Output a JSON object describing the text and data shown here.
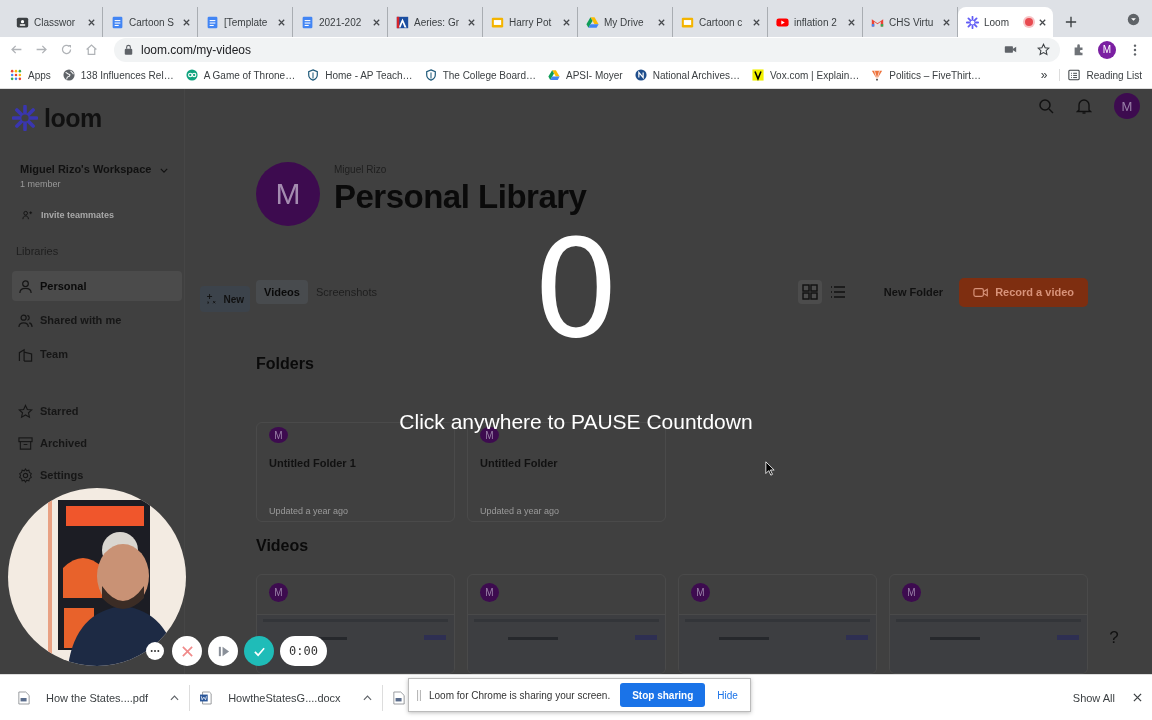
{
  "browser": {
    "tabs": [
      {
        "title": "Classwor",
        "kind": "classroom",
        "selected": false,
        "recording": false
      },
      {
        "title": "Cartoon S",
        "kind": "docs",
        "selected": false,
        "recording": false
      },
      {
        "title": "[Template",
        "kind": "docs",
        "selected": false,
        "recording": false
      },
      {
        "title": "2021-202",
        "kind": "docs",
        "selected": false,
        "recording": false
      },
      {
        "title": "Aeries: Gr",
        "kind": "aeries",
        "selected": false,
        "recording": false
      },
      {
        "title": "Harry Pot",
        "kind": "slides",
        "selected": false,
        "recording": false
      },
      {
        "title": "My Drive",
        "kind": "drive",
        "selected": false,
        "recording": false
      },
      {
        "title": "Cartoon c",
        "kind": "slides",
        "selected": false,
        "recording": false
      },
      {
        "title": "inflation 2",
        "kind": "youtube",
        "selected": false,
        "recording": false
      },
      {
        "title": "CHS Virtu",
        "kind": "gmail",
        "selected": false,
        "recording": false
      },
      {
        "title": "Loom",
        "kind": "loom",
        "selected": true,
        "recording": true
      }
    ],
    "address": "loom.com/my-videos",
    "profile": "M",
    "bookmarks": [
      {
        "label": "Apps",
        "kind": "apps"
      },
      {
        "label": "138 Influences Rel…",
        "kind": "globe"
      },
      {
        "label": "A Game of Throne…",
        "kind": "game"
      },
      {
        "label": "Home - AP Teach…",
        "kind": "shield"
      },
      {
        "label": "The College Board…",
        "kind": "shield"
      },
      {
        "label": "APSI- Moyer",
        "kind": "drive"
      },
      {
        "label": "National Archives…",
        "kind": "letter-n"
      },
      {
        "label": "Vox.com | Explain…",
        "kind": "letter-v"
      },
      {
        "label": "Politics – FiveThirt…",
        "kind": "fan"
      }
    ],
    "overflow": "»",
    "reading_list": "Reading List"
  },
  "loom": {
    "logo": "loom",
    "workspace": {
      "name": "Miguel Rizo's Workspace",
      "members": "1 member"
    },
    "invite": "Invite teammates",
    "libraries_heading": "Libraries",
    "nav": [
      {
        "label": "Personal",
        "kind": "person",
        "selected": true
      },
      {
        "label": "Shared with me",
        "kind": "people",
        "selected": false
      },
      {
        "label": "Team",
        "kind": "team",
        "selected": false
      }
    ],
    "more_nav": [
      {
        "label": "Starred",
        "kind": "star"
      },
      {
        "label": "Archived",
        "kind": "archive"
      },
      {
        "label": "Settings",
        "kind": "gear"
      }
    ],
    "account_avatar": "M",
    "user_avatar": "M",
    "owner": "Miguel Rizo",
    "title": "Personal Library",
    "new_button": "New",
    "view_tabs": [
      {
        "label": "Videos",
        "selected": true
      },
      {
        "label": "Screenshots",
        "selected": false
      }
    ],
    "layout_toggle": [
      {
        "kind": "grid",
        "selected": true
      },
      {
        "kind": "list",
        "selected": false
      }
    ],
    "new_folder": "New Folder",
    "record": "Record a video",
    "folders_heading": "Folders",
    "folders": [
      {
        "avatar": "M",
        "name": "Untitled Folder 1",
        "updated": "Updated a year ago"
      },
      {
        "avatar": "M",
        "name": "Untitled Folder",
        "updated": "Updated a year ago"
      }
    ],
    "videos_heading": "Videos",
    "videos": [
      {
        "avatar": "M"
      },
      {
        "avatar": "M"
      },
      {
        "avatar": "M"
      },
      {
        "avatar": "M"
      }
    ],
    "help": "?"
  },
  "countdown": {
    "number": "0",
    "message": "Click anywhere to PAUSE Countdown"
  },
  "recorder": {
    "time": "0:00"
  },
  "downloads": {
    "items": [
      {
        "name": "How the States....pdf",
        "kind": "pdf"
      },
      {
        "name": "HowtheStatesG....docx",
        "kind": "docx"
      },
      {
        "kind": "pdf"
      }
    ],
    "show_all": "Show All"
  },
  "share_banner": {
    "message": "Loom for Chrome is sharing your screen.",
    "stop": "Stop sharing",
    "hide": "Hide"
  }
}
